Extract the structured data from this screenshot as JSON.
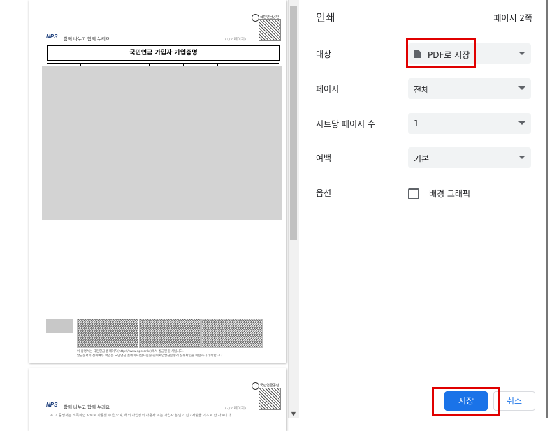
{
  "preview": {
    "page1": {
      "seal_label": "국민연금공단",
      "logo": "NPS",
      "slogan": "함께 나누고 함께 누리요",
      "page_number": "(1/2 페이지)",
      "doc_title": "국민연금 가입자 가입증명",
      "footer_line1": "이 증명서는 국민연금 홈페이지(http://www.nps.or.kr)에서 발급된 문서입니다.",
      "footer_line2": "발급문서의 진위여부 확인은 국민연금 홈페이지(전자민원)진위확인발급증명서 진위확인을 이용하시기 바랍니다."
    },
    "page2": {
      "seal_label": "국민연금공단",
      "logo": "NPS",
      "slogan": "함께 나누고 함께 누리요",
      "page_number": "(2/2 페이지)",
      "notice": "※ 이 증명서는 소득확인 자료로 사용할 수 없으며, 해외 사업장의 사용자 또는 가입자 본인의 신고사항을 기초로 한 자료이다"
    }
  },
  "settings": {
    "heading": "인쇄",
    "page_count": "페이지 2쪽",
    "destination": {
      "label": "대상",
      "value": "PDF로 저장"
    },
    "pages": {
      "label": "페이지",
      "value": "전체"
    },
    "pages_per_sheet": {
      "label": "시트당 페이지 수",
      "value": "1"
    },
    "margins": {
      "label": "여백",
      "value": "기본"
    },
    "options": {
      "label": "옵션",
      "checkbox_label": "배경 그래픽",
      "checked": false
    },
    "save_label": "저장",
    "cancel_label": "취소"
  },
  "colors": {
    "accent": "#1a73e8",
    "highlight": "#e00000",
    "select_bg": "#f1f3f4"
  }
}
